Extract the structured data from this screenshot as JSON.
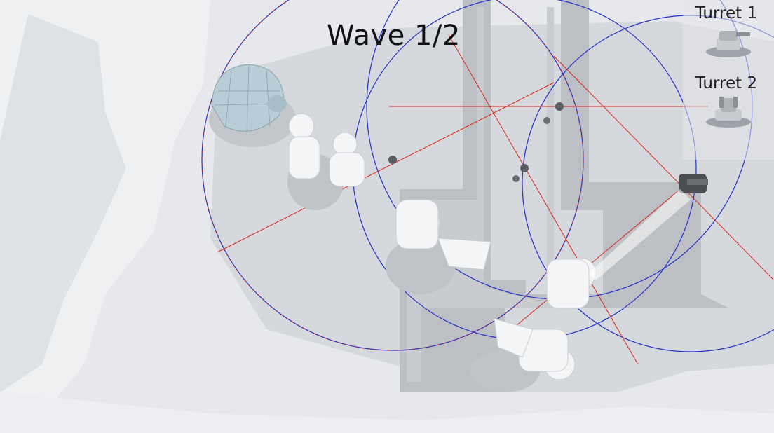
{
  "hud": {
    "wave": "Wave 1/2"
  },
  "shop": {
    "items": [
      {
        "label": "Turret 1",
        "icon": "turret-icon"
      },
      {
        "label": "Turret 2",
        "icon": "turret-icon"
      }
    ]
  },
  "colors": {
    "snow": "#e8eaed",
    "ground": "#d4d7db",
    "path": "#b9bcc1",
    "radius_ring": "#2430c8",
    "target_line": "#d8281c",
    "igloo": "#b9cdd6"
  }
}
